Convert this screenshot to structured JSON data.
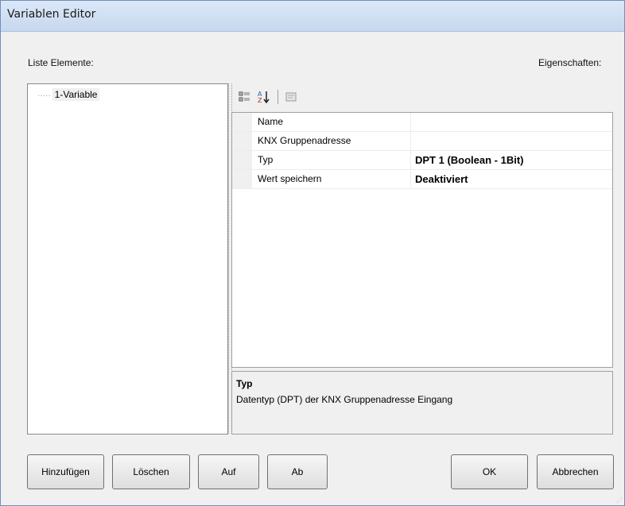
{
  "window": {
    "title": "Variablen Editor"
  },
  "labels": {
    "list": "Liste Elemente:",
    "properties": "Eigenschaften:"
  },
  "tree": {
    "items": [
      {
        "label": "1-Variable"
      }
    ]
  },
  "toolbar": {
    "categorized_icon": "categorized-view-icon",
    "alphabetical_icon": "sort-az-icon",
    "pages_icon": "property-pages-icon"
  },
  "properties": [
    {
      "name": "Name",
      "value": ""
    },
    {
      "name": "KNX Gruppenadresse",
      "value": ""
    },
    {
      "name": "Typ",
      "value": "DPT 1 (Boolean - 1Bit)"
    },
    {
      "name": "Wert speichern",
      "value": "Deaktiviert"
    }
  ],
  "description": {
    "title": "Typ",
    "text": "Datentyp (DPT) der KNX Gruppenadresse Eingang"
  },
  "buttons": {
    "add": "Hinzufügen",
    "delete": "Löschen",
    "up": "Auf",
    "down": "Ab",
    "ok": "OK",
    "cancel": "Abbrechen"
  }
}
